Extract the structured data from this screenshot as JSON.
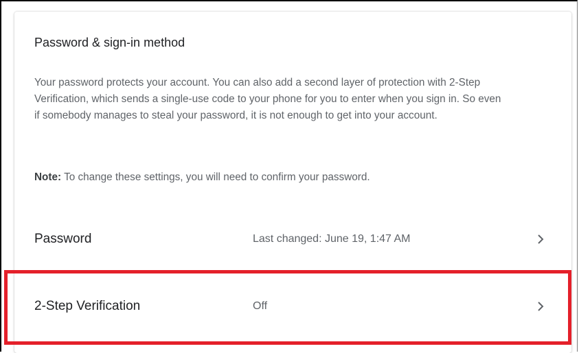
{
  "section": {
    "title": "Password & sign-in method",
    "description": "Your password protects your account. You can also add a second layer of protection with 2-Step Verification, which sends a single-use code to your phone for you to enter when you sign in. So even if somebody manages to steal your password, it is not enough to get into your account.",
    "note_label": "Note:",
    "note_text": " To change these settings, you will need to confirm your password."
  },
  "settings": [
    {
      "label": "Password",
      "value": "Last changed: June 19, 1:47 AM",
      "icon": "chevron-right-icon"
    },
    {
      "label": "2-Step Verification",
      "value": "Off",
      "icon": "chevron-right-icon"
    }
  ],
  "colors": {
    "highlight": "#e4202a",
    "primary_text": "#202124",
    "secondary_text": "#5f6368"
  }
}
